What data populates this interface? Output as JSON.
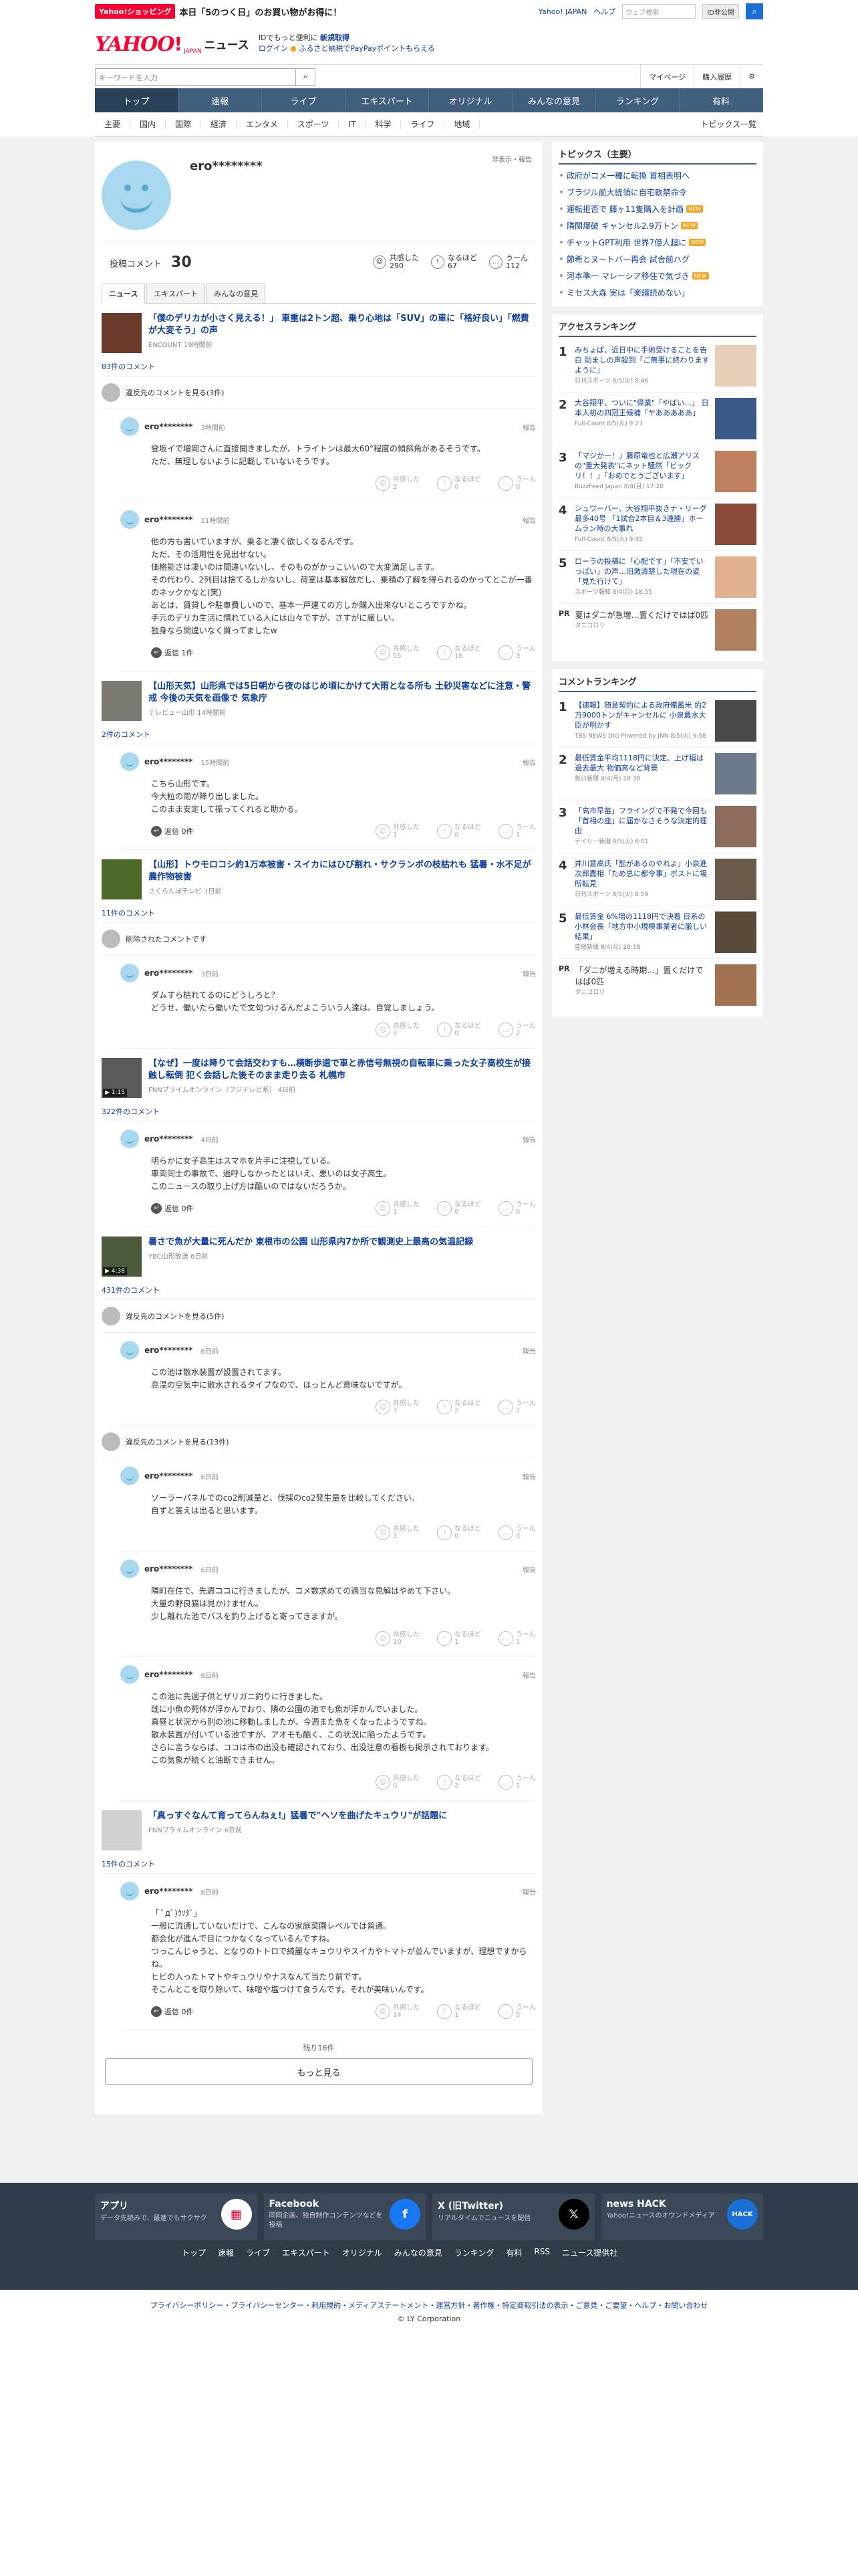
{
  "promo": {
    "badge": "Yahoo!ショッピング",
    "text": "本日「5のつく日」のお買い物がお得に！",
    "yjapan": "Yahoo! JAPAN",
    "help": "ヘルプ",
    "search_placeholder": "ウェブ検索",
    "search_btn": "ID非公開"
  },
  "header": {
    "logo_y": "YAHOO",
    "logo_ex": "!",
    "logo_jp": "JAPAN",
    "logo_news": "ニュース",
    "note1": "IDでもっと便利に",
    "note1b": "新規取得",
    "note2a": "ログイン",
    "note2b": "ふるさと納税でPayPayポイントもらえる"
  },
  "toolbar": {
    "keyword_placeholder": "キーワードを入力",
    "mypage": "マイページ",
    "history": "購入履歴"
  },
  "nav": [
    "トップ",
    "速報",
    "ライブ",
    "エキスパート",
    "オリジナル",
    "みんなの意見",
    "ランキング",
    "有料"
  ],
  "subnav": [
    "主要",
    "国内",
    "国際",
    "経済",
    "エンタメ",
    "スポーツ",
    "IT",
    "科学",
    "ライフ",
    "地域"
  ],
  "subnav_right": "トピックス一覧",
  "profile": {
    "name": "ero********",
    "report": "非表示・報告",
    "count_label": "投稿コメント",
    "count": "30",
    "reactions": [
      {
        "icon": "☺",
        "label": "共感した",
        "value": "290"
      },
      {
        "icon": "!",
        "label": "なるほど",
        "value": "67"
      },
      {
        "icon": "…",
        "label": "うーん",
        "value": "112"
      }
    ]
  },
  "tabs": [
    "ニュース",
    "エキスパート",
    "みんなの意見"
  ],
  "reaction_labels": [
    "共感した",
    "なるほど",
    "うーん"
  ],
  "sections": [
    {
      "title": "「僕のデリカが小さく見える！」 車重は2トン超、乗り心地は「SUV」の車に「格好良い」「燃費が大変そう」の声",
      "source": "ENCOUNT 19時間前",
      "count": "83件のコメント",
      "note": "違反先のコメントを見る(3件)",
      "thumb": "#6a3a2a",
      "comments": [
        {
          "user": "ero********",
          "time": "3時間前",
          "text": "登坂イで増岡さんに直接聞きましたが、トライトンは最大60°程度の傾斜角があるそうです。\nただ、無理しないように記載していないそうです。",
          "reply": "",
          "r": [
            "3",
            "0",
            "0"
          ]
        },
        {
          "user": "ero********",
          "time": "11時間前",
          "text": "他の方も書いていますが、乗ると凄く欲しくなるんです。\nただ、その活用性を見出せない。\n価格能さは凄いのは間違いないし、そのものがかっこいいので大変満足します。\nその代わり、2列目は捨てるしかないし、荷室は基本解放だし、乗積の了解を得られるのかってとこが一番のネックかなと(笑)\nあとは、賃貸しや駐車費しいので、基本一戸建ての方しか購入出来ないところですかね。\n手元のデリカ生活に慣れている人には山々ですが、さすがに厳しい。\n独身なら間違いなく買ってましたw",
          "reply": "返信 1件",
          "r": [
            "55",
            "16",
            "3"
          ]
        }
      ]
    },
    {
      "title": "【山形天気】山形県では5日朝から夜のはじめ頃にかけて大雨となる所も 土砂災害などに注意・警戒 今後の天気を画像で 気象庁",
      "source": "テレビュー山形 14時間前",
      "count": "2件のコメント",
      "note": "",
      "thumb": "#7a7a70",
      "comments": [
        {
          "user": "ero********",
          "time": "15時間前",
          "text": "こちら山形です。\n今大粒の雨が降り出しました。\nこのまま安定して振ってくれると助かる。",
          "reply": "返信 0件",
          "r": [
            "1",
            "0",
            "1"
          ]
        }
      ]
    },
    {
      "title": "【山形】トウモロコシ約1万本被害・スイカにはひび割れ・サクランボの枝枯れも 猛暑・水不足が農作物被害",
      "source": "さくらんぼテレビ 1日前",
      "count": "11件のコメント",
      "note": "削除されたコメントです",
      "thumb": "#4a6a2a",
      "comments": [
        {
          "user": "ero********",
          "time": "3日前",
          "text": "ダムすら枯れてるのにどうしろと？\nどうせ、働いたら働いたで文句つけるんだよこういう人達は。自覚しましょう。",
          "reply": "",
          "r": [
            "5",
            "0",
            "2"
          ]
        }
      ]
    },
    {
      "title": "【なぜ】一度は降りて会話交わすも…横断歩道で車と赤信号無視の自転車に乗った女子高校生が接触し転倒 犯く会話した後そのまま走り去る 札幌市",
      "source": "FNNプライムオンライン（フジテレビ系） 4日前",
      "count": "322件のコメント",
      "note": "",
      "thumb": "#5a5a5a",
      "vt": "▶ 1:15",
      "comments": [
        {
          "user": "ero********",
          "time": "4日前",
          "text": "明らかに女子高生はスマホを片手に注視している。\n車両同士の事故で、過呼しなかったとはいえ、悪いのは女子高生。\nこのニュースの取り上げ方は酷いのではないだろうか。",
          "reply": "返信 0件",
          "r": [
            "1",
            "0",
            "0"
          ]
        }
      ]
    },
    {
      "title": "暑さで魚が大量に死んだか 東根市の公園 山形県内7か所で観測史上最高の気温記録",
      "source": "YBC山形放送 6日前",
      "count": "431件のコメント",
      "note": "違反先のコメントを見る(5件)",
      "thumb": "#4a5a3a",
      "vt": "▶ 4:38",
      "comments": [
        {
          "user": "ero********",
          "time": "6日前",
          "text": "この池は散水装置が設置されてます。\n高温の空気中に散水されるタイプなので、ほっとんど意味ないですが。",
          "reply": "",
          "r": [
            "3",
            "2",
            "2"
          ]
        }
      ]
    }
  ],
  "note_mid": "違反先のコメントを見る(13件)",
  "thread": [
    {
      "user": "ero********",
      "time": "6日前",
      "text": "ソーラーパネルでのco2削減量と、伐採のco2発生量を比較してください。\n自ずと答えは出ると思います。",
      "r": [
        "3",
        "0",
        "0"
      ]
    },
    {
      "user": "ero********",
      "time": "6日前",
      "text": "隣町在住で、先週ココに行きましたが、コメ数求めての適当な見解はやめて下さい。\n大量の野良猫は見かけません。\n少し離れた池でバスを釣り上げると寄ってきますが。",
      "r": [
        "10",
        "1",
        "1"
      ]
    },
    {
      "user": "ero********",
      "time": "6日前",
      "text": "この池に先週子供とザリガニ釣りに行きました。\n既に小魚の死体が浮かんでおり、隣の公園の池でも魚が浮かんでいました。\n真昼と状況から別の池に移動しましたが、今週また魚をくなったようですね。\n散水装置が付いている池ですが、アオモも酷く、この状況に陥ったようです。\nさらに言うならば、ココは市の出没も確認されており、出没注意の看板も掲示されております。\nこの気象が続くと油断できません。",
      "r": [
        "0",
        "2",
        "1"
      ]
    }
  ],
  "last_section": {
    "title": "「真っすぐなんて育ってらんねぇ!」猛暑で\"ヘソを曲げたキュウリ\"が話題に",
    "source": "FNNプライムオンライン 6日前",
    "count": "15件のコメント",
    "thumb": "#d0d0d0"
  },
  "last_comment": {
    "user": "ero********",
    "time": "6日前",
    "text": "「 ﾟдﾟ)ｳｿﾀﾞ」\n一般に流通していないだけで、こんなの家庭菜園レベルでは普通。\n都会化が進んで目につかなくなっているんですね。\nつっこんじゃうと、となりのトトロで綺麗なキュウリやスイカやトマトが並んでいますが、理想ですからね。\nヒビの入ったトマトやキュウリやナスなんて当たり前です。\nそこんとこを取り除いて、味噌や塩つけて食うんです。それが美味いんです。",
    "reply": "返信 0件",
    "r": [
      "14",
      "1",
      "5"
    ]
  },
  "remain": "残り16件",
  "more": "もっと見る",
  "sidebar": {
    "topics_title": "トピックス（主要）",
    "topics": [
      {
        "t": "政府がコメ一種に転換 首相表明へ",
        "n": ""
      },
      {
        "t": "ブラジル前大統領に自宅軟禁命令",
        "n": ""
      },
      {
        "t": "運転拒否で 藤ヶ11隻購入を計画",
        "n": "NEW"
      },
      {
        "t": "隣関爆破 キャンセル2.9万トン",
        "n": "NEW"
      },
      {
        "t": "チャットGPT利用 世界7億人超に",
        "n": "NEW"
      },
      {
        "t": "節希とヌートバー再会 試合前ハグ",
        "n": ""
      },
      {
        "t": "河本準一 マレーシア移住で気づき",
        "n": "NEW"
      },
      {
        "t": "ミセス大森 実は「楽譜読めない」",
        "n": ""
      }
    ],
    "ranking_title": "アクセスランキング",
    "ranking": [
      {
        "n": "1",
        "t": "みちょぱ、近日中に手術受けることを告白 助ましの声殺到「ご無事に終わりますように」",
        "s": "日刊スポーツ 8/5(火) 8:46",
        "c": "#e8d0b8"
      },
      {
        "n": "2",
        "t": "大谷翔平、ついに\"偉業\"「やばい…」 日本人初の四冠王候補「ヤあああああ」",
        "s": "Full-Count 8/5(火) 9:23",
        "c": "#3a5a8a"
      },
      {
        "n": "3",
        "t": "「マジかー！」藤原竜也と広瀬アリスの\"重大発表\"にネット騒然「ビックリ！！」「おめでとうございます」",
        "s": "BuzzFeed Japan 8/4(月) 17:20",
        "c": "#c08060"
      },
      {
        "n": "4",
        "t": "シュワーバー、大谷翔平抜きナ・リーグ最多40号 「1試合2本目＆3連勝」ホームラン時の大事れ",
        "s": "Full-Count 8/5(火) 9:45",
        "c": "#8a4a3a"
      },
      {
        "n": "5",
        "t": "ローラの投稿に「心配です」「不安でいっぱい」の声…旧激清楚した現在の姿「見た行けて」",
        "s": "スポーツ報知 8/4(月) 18:55",
        "c": "#e0b090"
      }
    ],
    "pr1": {
      "b": "PR",
      "t": "夏はダニが急増…置くだけではば0匹",
      "s": "ダニコロリ",
      "c": "#b08060"
    },
    "cranking_title": "コメントランキング",
    "cranking": [
      {
        "n": "1",
        "t": "【速報】随意契約による政府備蓄米 約2万9000トンがキャンセルに 小泉農水大臣が明かす",
        "s": "TBS NEWS DIG Powered by JNN 8/5(火) 9:58",
        "c": "#4a4a4a"
      },
      {
        "n": "2",
        "t": "最低賃金平均1118円に決定、上げ幅は過去最大 物価高など背景",
        "s": "毎日新聞 8/4(月) 18:38",
        "c": "#6a7a8a"
      },
      {
        "n": "3",
        "t": "「高市早苗」フライングで不発で今回も「首相の座」に届かなさそうな決定的理由",
        "s": "デイリー新潮 8/5(火) 6:01",
        "c": "#8a6a5a"
      },
      {
        "n": "4",
        "t": "井川意高氏「髭があるのやれよ」小泉進次郎農相「ため息に都令事」ポストに場所転見",
        "s": "日刊スポーツ 8/5(火) 8:59",
        "c": "#6a5a4a"
      },
      {
        "n": "5",
        "t": "最低賃金 6%増の1118円で決着 日系の小林会長「地方中小規模事業者に厳しい結果」",
        "s": "産経新聞 8/4(月) 20:18",
        "c": "#5a4a3a"
      }
    ],
    "pr2": {
      "b": "PR",
      "t": "「ダニが増える時期…」置くだけではば0匹",
      "s": "ダニコロリ",
      "c": "#a07050"
    }
  },
  "footer": {
    "apps": [
      {
        "t": "アプリ",
        "d": "データ先読みで、最速でもサクサク",
        "ico": "▦",
        "c": "#fff",
        "fc": "#ff0033"
      },
      {
        "t": "Facebook",
        "d": "同同企画、独自制作コンテンツなどを投稿",
        "ico": "f",
        "c": "#1877f2",
        "fc": "#fff"
      },
      {
        "t": "X (旧Twitter)",
        "d": "リアルタイムでニュースを配信",
        "ico": "𝕏",
        "c": "#000",
        "fc": "#fff"
      },
      {
        "t": "news HACK",
        "d": "Yahoo!ニュースのオウンドメディア",
        "ico": "HACK",
        "c": "#1a6fd6",
        "fc": "#fff"
      }
    ],
    "nav": [
      "トップ",
      "速報",
      "ライブ",
      "エキスパート",
      "オリジナル",
      "みんなの意見",
      "ランキング",
      "有料",
      "RSS",
      "ニュース提供社"
    ],
    "links": "プライバシーポリシー・プライバシーセンター・利用規約・メディアステートメント・運営方針・著作権・特定商取引法の表示・ご意見・ご要望・ヘルプ・お問い合わせ",
    "copyright": "© LY Corporation"
  }
}
